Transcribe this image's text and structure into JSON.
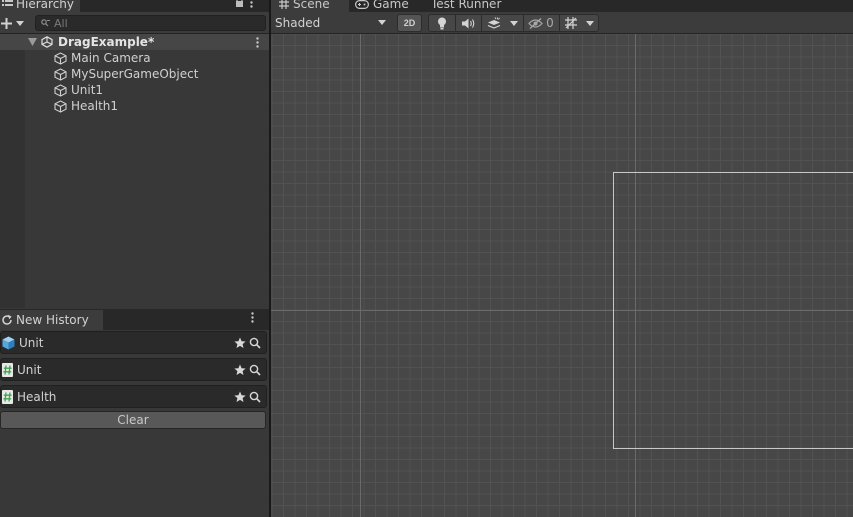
{
  "hierarchy": {
    "tab_label": "Hierarchy",
    "search_placeholder": "All",
    "scene_name": "DragExample*",
    "objects": [
      {
        "label": "Main Camera"
      },
      {
        "label": "MySuperGameObject"
      },
      {
        "label": "Unit1"
      },
      {
        "label": "Health1"
      }
    ]
  },
  "history": {
    "tab_label": "New History",
    "items": [
      {
        "label": "Unit",
        "icon": "prefab-cube-icon",
        "icon_color": "#57a6de"
      },
      {
        "label": "Unit",
        "icon": "csharp-script-icon",
        "icon_color": "#3fa34d"
      },
      {
        "label": "Health",
        "icon": "csharp-script-icon",
        "icon_color": "#3fa34d"
      }
    ],
    "clear_label": "Clear"
  },
  "scene_tabs": [
    {
      "label": "Scene",
      "icon": "grid-hash-icon",
      "active": true
    },
    {
      "label": "Game",
      "icon": "gamepad-icon",
      "active": false
    },
    {
      "label": "Test Runner",
      "icon": "",
      "active": false
    }
  ],
  "scene_toolbar": {
    "shading_mode": "Shaded",
    "mode_2d_label": "2D",
    "hidden_count": "0"
  },
  "colors": {
    "panel_bg": "#383838",
    "scene_bg": "#474747",
    "grid_line": "#525252",
    "axis_line": "#6a6a6a",
    "camera_frame": "#c8c8c8"
  }
}
